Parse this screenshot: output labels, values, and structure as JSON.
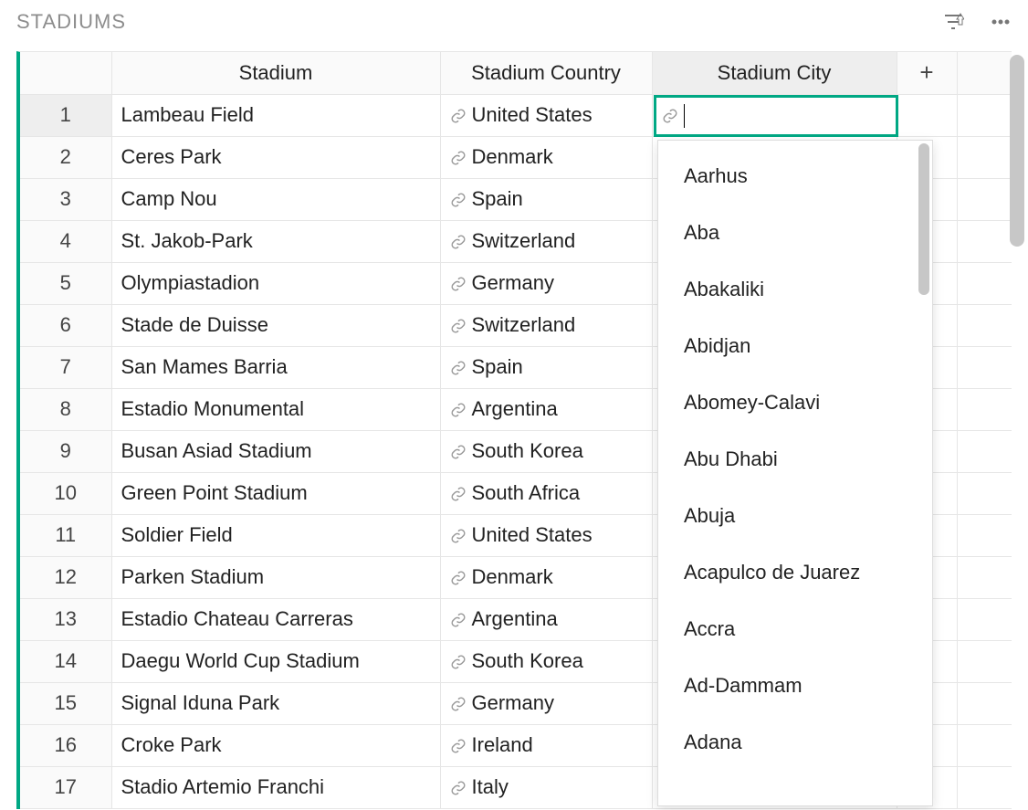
{
  "header": {
    "title": "STADIUMS"
  },
  "columns": {
    "stadium": "Stadium",
    "country": "Stadium Country",
    "city": "Stadium City",
    "add": "+"
  },
  "rows": [
    {
      "num": "1",
      "stadium": "Lambeau Field",
      "country": "United States"
    },
    {
      "num": "2",
      "stadium": "Ceres Park",
      "country": "Denmark"
    },
    {
      "num": "3",
      "stadium": "Camp Nou",
      "country": "Spain"
    },
    {
      "num": "4",
      "stadium": "St. Jakob-Park",
      "country": "Switzerland"
    },
    {
      "num": "5",
      "stadium": "Olympiastadion",
      "country": "Germany"
    },
    {
      "num": "6",
      "stadium": "Stade de Duisse",
      "country": "Switzerland"
    },
    {
      "num": "7",
      "stadium": "San Mames Barria",
      "country": "Spain"
    },
    {
      "num": "8",
      "stadium": "Estadio Monumental",
      "country": "Argentina"
    },
    {
      "num": "9",
      "stadium": "Busan Asiad Stadium",
      "country": "South Korea"
    },
    {
      "num": "10",
      "stadium": "Green Point Stadium",
      "country": "South Africa"
    },
    {
      "num": "11",
      "stadium": "Soldier Field",
      "country": "United States"
    },
    {
      "num": "12",
      "stadium": "Parken Stadium",
      "country": "Denmark"
    },
    {
      "num": "13",
      "stadium": "Estadio Chateau Carreras",
      "country": "Argentina"
    },
    {
      "num": "14",
      "stadium": "Daegu World Cup Stadium",
      "country": "South Korea"
    },
    {
      "num": "15",
      "stadium": "Signal Iduna Park",
      "country": "Germany"
    },
    {
      "num": "16",
      "stadium": "Croke Park",
      "country": "Ireland"
    },
    {
      "num": "17",
      "stadium": "Stadio Artemio Franchi",
      "country": "Italy"
    }
  ],
  "editing": {
    "value": ""
  },
  "dropdown": {
    "items": [
      "Aarhus",
      "Aba",
      "Abakaliki",
      "Abidjan",
      "Abomey-Calavi",
      "Abu Dhabi",
      "Abuja",
      "Acapulco de Juarez",
      "Accra",
      "Ad-Dammam",
      "Adana"
    ],
    "thumbHeightPx": 166
  },
  "colors": {
    "accent": "#00a884"
  }
}
